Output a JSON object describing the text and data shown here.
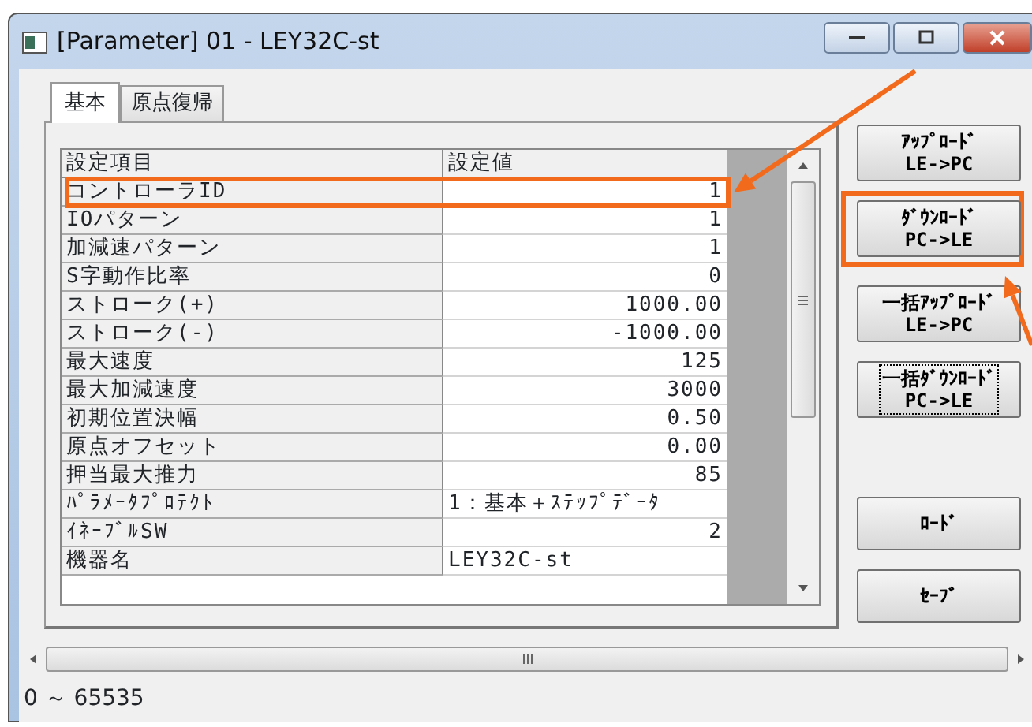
{
  "window": {
    "title": "[Parameter] 01 - LEY32C-st"
  },
  "tabs": [
    {
      "label": "基本",
      "selected": true
    },
    {
      "label": "原点復帰",
      "selected": false
    }
  ],
  "table": {
    "columns": [
      "設定項目",
      "設定値"
    ],
    "rows": [
      {
        "name": "コントローラID",
        "value": "1",
        "kind": "number",
        "highlighted": true
      },
      {
        "name": "IOパターン",
        "value": "1",
        "kind": "number",
        "highlighted": false
      },
      {
        "name": "加減速パターン",
        "value": "1",
        "kind": "number",
        "highlighted": false
      },
      {
        "name": "S字動作比率",
        "value": "0",
        "kind": "number",
        "highlighted": false
      },
      {
        "name": "ストローク(+)",
        "value": "1000.00",
        "kind": "number",
        "highlighted": false
      },
      {
        "name": "ストローク(-)",
        "value": "-1000.00",
        "kind": "number",
        "highlighted": false
      },
      {
        "name": "最大速度",
        "value": "125",
        "kind": "number",
        "highlighted": false
      },
      {
        "name": "最大加減速度",
        "value": "3000",
        "kind": "number",
        "highlighted": false
      },
      {
        "name": "初期位置決幅",
        "value": "0.50",
        "kind": "number",
        "highlighted": false
      },
      {
        "name": "原点オフセット",
        "value": "0.00",
        "kind": "number",
        "highlighted": false
      },
      {
        "name": "押当最大推力",
        "value": "85",
        "kind": "number",
        "highlighted": false
      },
      {
        "name": "ﾊﾟﾗﾒｰﾀﾌﾟﾛﾃｸﾄ",
        "value": "1：基本＋ｽﾃｯﾌﾟﾃﾞｰﾀ",
        "kind": "text",
        "highlighted": false
      },
      {
        "name": "ｲﾈｰﾌﾞﾙSW",
        "value": "2",
        "kind": "number",
        "highlighted": false
      },
      {
        "name": "機器名",
        "value": "LEY32C-st",
        "kind": "text",
        "highlighted": false
      }
    ]
  },
  "transfer_buttons": [
    {
      "lines": [
        "ｱｯﾌﾟﾛｰﾄﾞ",
        "LE->PC"
      ],
      "focused": false,
      "highlighted": false
    },
    {
      "lines": [
        "ﾀﾞｳﾝﾛｰﾄﾞ",
        "PC->LE"
      ],
      "focused": false,
      "highlighted": true
    },
    {
      "lines": [
        "一括ｱｯﾌﾟﾛｰﾄﾞ",
        "LE->PC"
      ],
      "focused": false,
      "highlighted": false
    },
    {
      "lines": [
        "一括ﾀﾞｳﾝﾛｰﾄﾞ",
        "PC->LE"
      ],
      "focused": true,
      "highlighted": false
    }
  ],
  "file_buttons": [
    {
      "lines": [
        "ﾛｰﾄﾞ"
      ],
      "focused": false,
      "highlighted": false
    },
    {
      "lines": [
        "ｾｰﾌﾞ"
      ],
      "focused": false,
      "highlighted": false
    }
  ],
  "status_bar": {
    "text": "0 ～ 65535"
  }
}
